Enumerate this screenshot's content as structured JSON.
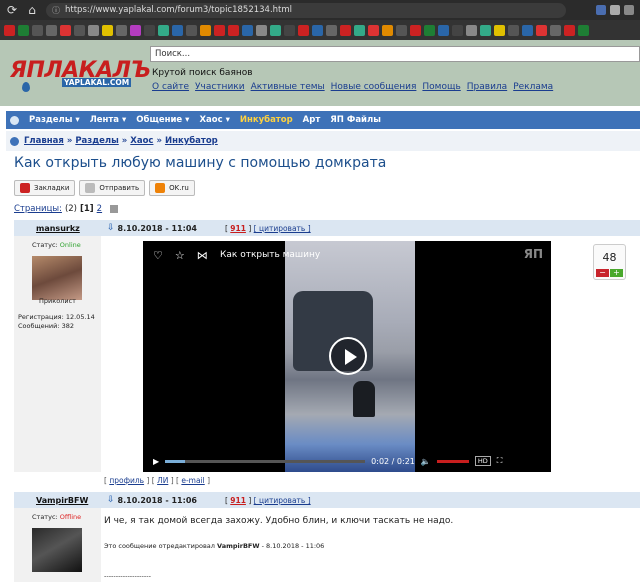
{
  "browser": {
    "url": "https://www.yaplakal.com/forum3/topic1852134.html"
  },
  "site": {
    "logo_text": "ЯПЛАКАЛЪ",
    "logo_sub": "YAPLAKAL.COM",
    "search_placeholder": "Поиск...",
    "slogan": "Крутой поиск баянов",
    "links": [
      "О сайте",
      "Участники",
      "Активные темы",
      "Новые сообщения",
      "Помощь",
      "Правила",
      "Реклама"
    ]
  },
  "nav": {
    "items": [
      "Разделы ▾",
      "Лента ▾",
      "Общение ▾",
      "Хаос ▾",
      "Инкубатор",
      "Арт",
      "ЯП Файлы"
    ]
  },
  "breadcrumb": [
    "Главная",
    "Разделы",
    "Хаос",
    "Инкубатор"
  ],
  "topic": {
    "title": "Как открыть любую машину с помощью домкрата",
    "share_buttons": [
      "Закладки",
      "Отправить",
      "OK.ru"
    ],
    "pages_label": "Страницы:",
    "pages_count": "(2)",
    "page_current": "[1]",
    "page_next": "2"
  },
  "posts": [
    {
      "author": "mansurkz",
      "date": "8.10.2018 - 11:04",
      "rep_open": "[",
      "rep_num": "911",
      "rep_close": "]",
      "quote": "[ цитировать ]",
      "status_label": "Статус:",
      "status": "Online",
      "rank": "Приколист",
      "reg": "Регистрация: 12.05.14",
      "messages": "Сообщений: 382",
      "video_title": "Как открыть машину",
      "video_time": "0:02 / 0:21",
      "video_progress": 0.1,
      "rating": "48",
      "footer": [
        "профиль",
        "ЛИ",
        "e-mail"
      ]
    },
    {
      "author": "VampirBFW",
      "date": "8.10.2018 - 11:06",
      "rep_open": "[",
      "rep_num": "911",
      "rep_close": "]",
      "quote": "[ цитировать ]",
      "status_label": "Статус:",
      "status": "Offline",
      "text": "И че, я так домой всегда захожу. Удобно блин, и ключи таскать не надо.",
      "edited_prefix": "Это сообщение отредактировал",
      "edited_user": "VampirBFW",
      "edited_date": "- 8.10.2018 - 11:06",
      "signature": "--------------------"
    }
  ]
}
